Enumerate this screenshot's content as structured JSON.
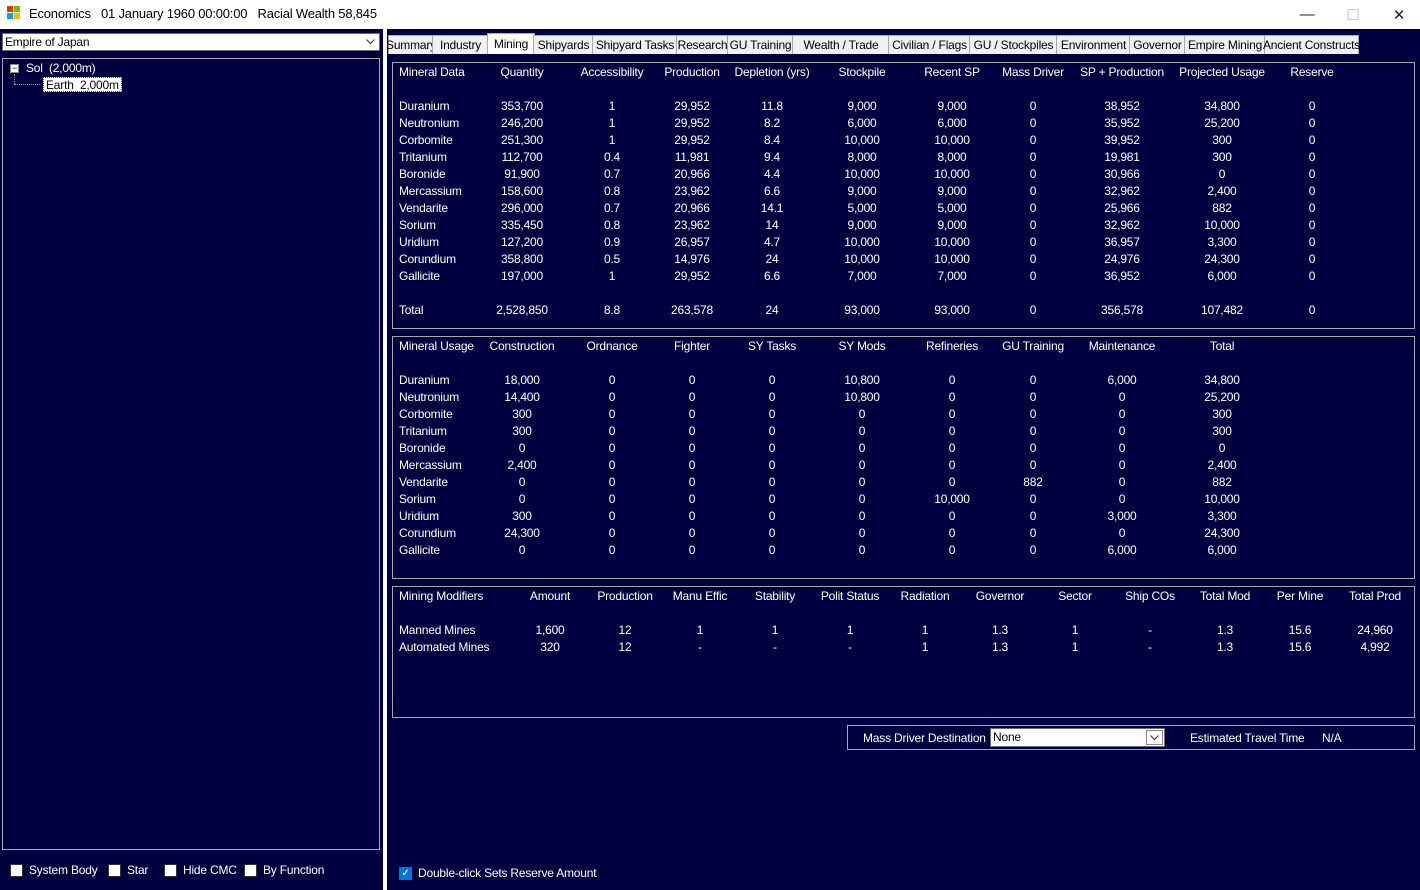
{
  "titlebar": {
    "title": "Economics   01 January 1960 00:00:00   Racial Wealth 58,845",
    "minimize": "—",
    "maximize": "☐",
    "close": "✕"
  },
  "left": {
    "empire": "Empire of Japan",
    "tree": {
      "expander": "−",
      "system": "Sol  (2,000m)",
      "body": "Earth  2,000m"
    },
    "checkboxes": [
      {
        "label": "System Body",
        "checked": false
      },
      {
        "label": "Star",
        "checked": false
      },
      {
        "label": "Hide CMC",
        "checked": false
      },
      {
        "label": "By Function",
        "checked": false
      }
    ]
  },
  "tabs": [
    "Summary",
    "Industry",
    "Mining",
    "Shipyards",
    "Shipyard Tasks",
    "Research",
    "GU Training",
    "Wealth / Trade",
    "Civilian / Flags",
    "GU / Stockpiles",
    "Environment",
    "Governor",
    "Empire Mining",
    "Ancient Constructs"
  ],
  "active_tab": "Mining",
  "mineral_data": {
    "headers": [
      "Mineral Data",
      "Quantity",
      "Accessibility",
      "Production",
      "Depletion (yrs)",
      "Stockpile",
      "Recent SP",
      "Mass Driver",
      "SP + Production",
      "Projected Usage",
      "Reserve"
    ],
    "rows": [
      [
        "Duranium",
        "353,700",
        "1",
        "29,952",
        "11.8",
        "9,000",
        "9,000",
        "0",
        "38,952",
        "34,800",
        "0"
      ],
      [
        "Neutronium",
        "246,200",
        "1",
        "29,952",
        "8.2",
        "6,000",
        "6,000",
        "0",
        "35,952",
        "25,200",
        "0"
      ],
      [
        "Corbomite",
        "251,300",
        "1",
        "29,952",
        "8.4",
        "10,000",
        "10,000",
        "0",
        "39,952",
        "300",
        "0"
      ],
      [
        "Tritanium",
        "112,700",
        "0.4",
        "11,981",
        "9.4",
        "8,000",
        "8,000",
        "0",
        "19,981",
        "300",
        "0"
      ],
      [
        "Boronide",
        "91,900",
        "0.7",
        "20,966",
        "4.4",
        "10,000",
        "10,000",
        "0",
        "30,966",
        "0",
        "0"
      ],
      [
        "Mercassium",
        "158,600",
        "0.8",
        "23,962",
        "6.6",
        "9,000",
        "9,000",
        "0",
        "32,962",
        "2,400",
        "0"
      ],
      [
        "Vendarite",
        "296,000",
        "0.7",
        "20,966",
        "14.1",
        "5,000",
        "5,000",
        "0",
        "25,966",
        "882",
        "0"
      ],
      [
        "Sorium",
        "335,450",
        "0.8",
        "23,962",
        "14",
        "9,000",
        "9,000",
        "0",
        "32,962",
        "10,000",
        "0"
      ],
      [
        "Uridium",
        "127,200",
        "0.9",
        "26,957",
        "4.7",
        "10,000",
        "10,000",
        "0",
        "36,957",
        "3,300",
        "0"
      ],
      [
        "Corundium",
        "358,800",
        "0.5",
        "14,976",
        "24",
        "10,000",
        "10,000",
        "0",
        "24,976",
        "24,300",
        "0"
      ],
      [
        "Gallicite",
        "197,000",
        "1",
        "29,952",
        "6.6",
        "7,000",
        "7,000",
        "0",
        "36,952",
        "6,000",
        "0"
      ]
    ],
    "total": [
      "Total",
      "2,528,850",
      "8.8",
      "263,578",
      "24",
      "93,000",
      "93,000",
      "0",
      "356,578",
      "107,482",
      "0"
    ]
  },
  "mineral_usage": {
    "headers": [
      "Mineral Usage",
      "Construction",
      "Ordnance",
      "Fighter",
      "SY Tasks",
      "SY Mods",
      "Refineries",
      "GU Training",
      "Maintenance",
      "Total"
    ],
    "rows": [
      [
        "Duranium",
        "18,000",
        "0",
        "0",
        "0",
        "10,800",
        "0",
        "0",
        "6,000",
        "34,800"
      ],
      [
        "Neutronium",
        "14,400",
        "0",
        "0",
        "0",
        "10,800",
        "0",
        "0",
        "0",
        "25,200"
      ],
      [
        "Corbomite",
        "300",
        "0",
        "0",
        "0",
        "0",
        "0",
        "0",
        "0",
        "300"
      ],
      [
        "Tritanium",
        "300",
        "0",
        "0",
        "0",
        "0",
        "0",
        "0",
        "0",
        "300"
      ],
      [
        "Boronide",
        "0",
        "0",
        "0",
        "0",
        "0",
        "0",
        "0",
        "0",
        "0"
      ],
      [
        "Mercassium",
        "2,400",
        "0",
        "0",
        "0",
        "0",
        "0",
        "0",
        "0",
        "2,400"
      ],
      [
        "Vendarite",
        "0",
        "0",
        "0",
        "0",
        "0",
        "0",
        "882",
        "0",
        "882"
      ],
      [
        "Sorium",
        "0",
        "0",
        "0",
        "0",
        "0",
        "10,000",
        "0",
        "0",
        "10,000"
      ],
      [
        "Uridium",
        "300",
        "0",
        "0",
        "0",
        "0",
        "0",
        "0",
        "3,000",
        "3,300"
      ],
      [
        "Corundium",
        "24,300",
        "0",
        "0",
        "0",
        "0",
        "0",
        "0",
        "0",
        "24,300"
      ],
      [
        "Gallicite",
        "0",
        "0",
        "0",
        "0",
        "0",
        "0",
        "0",
        "6,000",
        "6,000"
      ]
    ]
  },
  "mining_modifiers": {
    "headers": [
      "Mining Modifiers",
      "Amount",
      "Production",
      "Manu Effic",
      "Stability",
      "Polit Status",
      "Radiation",
      "Governor",
      "Sector",
      "Ship COs",
      "Total Mod",
      "Per Mine",
      "Total Prod"
    ],
    "rows": [
      [
        "Manned Mines",
        "1,600",
        "12",
        "1",
        "1",
        "1",
        "1",
        "1.3",
        "1",
        "-",
        "1.3",
        "15.6",
        "24,960"
      ],
      [
        "Automated Mines",
        "320",
        "12",
        "-",
        "-",
        "-",
        "1",
        "1.3",
        "1",
        "-",
        "1.3",
        "15.6",
        "4,992"
      ]
    ]
  },
  "mass_driver": {
    "label": "Mass Driver Destination",
    "value": "None",
    "travel_label": "Estimated Travel Time",
    "travel_value": "N/A"
  },
  "double_click": {
    "label": "Double-click Sets Reserve Amount",
    "checked": true
  }
}
